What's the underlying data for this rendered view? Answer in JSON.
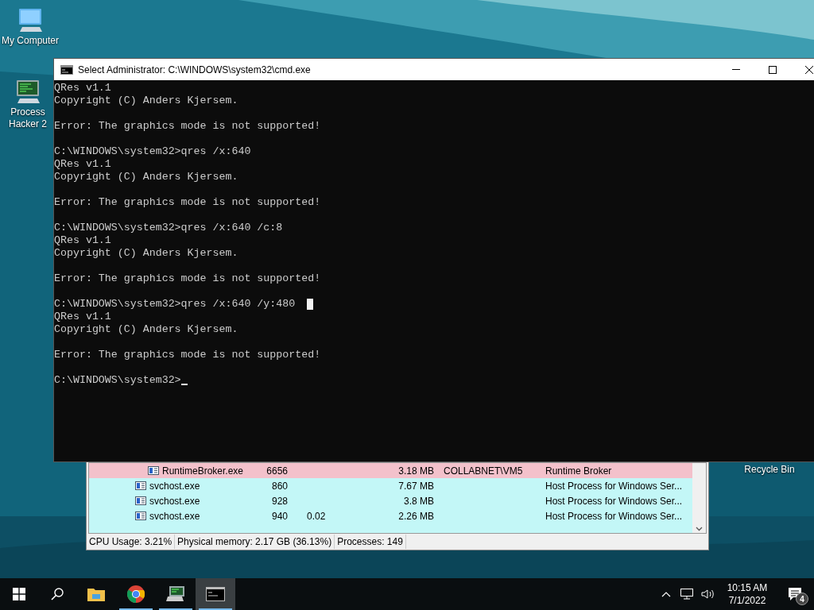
{
  "desktop_icons": [
    {
      "label": "My Computer",
      "kind": "computer"
    },
    {
      "label": "Process Hacker 2",
      "kind": "hacker"
    },
    {
      "label": "Recycle Bin",
      "kind": "bin"
    }
  ],
  "console": {
    "title": "Select Administrator: C:\\WINDOWS\\system32\\cmd.exe",
    "blocks": [
      [
        "QRes v1.1",
        "Copyright (C) Anders Kjersem."
      ],
      [
        "Error: The graphics mode is not supported!"
      ],
      [
        "C:\\WINDOWS\\system32>qres /x:640",
        "QRes v1.1",
        "Copyright (C) Anders Kjersem."
      ],
      [
        "Error: The graphics mode is not supported!"
      ],
      [
        "C:\\WINDOWS\\system32>qres /x:640 /c:8",
        "QRes v1.1",
        "Copyright (C) Anders Kjersem."
      ],
      [
        "Error: The graphics mode is not supported!"
      ],
      [
        "C:\\WINDOWS\\system32>qres /x:640 /y:480",
        "QRes v1.1",
        "Copyright (C) Anders Kjersem."
      ],
      [
        "Error: The graphics mode is not supported!"
      ]
    ],
    "prompt": "C:\\WINDOWS\\system32>"
  },
  "process_list": {
    "rows": [
      {
        "kind": "nested",
        "color": "#f3c1cb",
        "name": "RuntimeBroker.exe",
        "pid": "6656",
        "memory": "3.18 MB",
        "user": "COLLABNET\\VM5",
        "description": "Runtime Broker"
      },
      {
        "kind": "process",
        "color": "#c3f7f7",
        "name": "svchost.exe",
        "pid": "860",
        "memory": "7.67 MB",
        "description": "Host Process for Windows Ser..."
      },
      {
        "kind": "process",
        "color": "#c3f7f7",
        "name": "svchost.exe",
        "pid": "928",
        "memory": "3.8 MB",
        "description": "Host Process for Windows Ser..."
      },
      {
        "kind": "process",
        "color": "#c3f7f7",
        "name": "svchost.exe",
        "pid": "940",
        "cpu": "0.02",
        "memory": "2.26 MB",
        "description": "Host Process for Windows Ser..."
      }
    ],
    "status_bar": [
      "CPU Usage: 3.21%",
      "Physical memory: 2.17 GB (36.13%)",
      "Processes: 149"
    ]
  },
  "taskbar": {
    "apps": [
      {
        "kind": "explorer",
        "running": false,
        "selected": false
      },
      {
        "kind": "chrome",
        "running": true,
        "selected": false
      },
      {
        "kind": "hacker",
        "running": true,
        "selected": false
      },
      {
        "kind": "console",
        "running": true,
        "selected": true
      }
    ],
    "time": "10:15 AM",
    "date": "7/1/2022",
    "notification_count": "4"
  }
}
